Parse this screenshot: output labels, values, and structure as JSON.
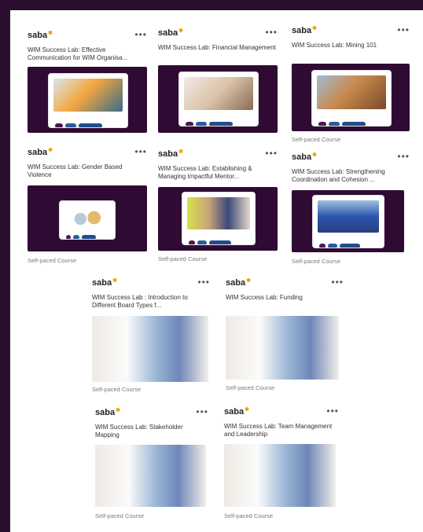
{
  "brand": "saba",
  "more_label": "•••",
  "course_type": "Self-paced Course",
  "cards": [
    {
      "title": "WIM Success Lab: Effective Communication for WIM Organisa..."
    },
    {
      "title": "WIM Success Lab: Financial Management"
    },
    {
      "title": "WIM Success Lab: Mining 101"
    },
    {
      "title": "WIM Success Lab: Gender Based Violence"
    },
    {
      "title": "WIM Success Lab: Establishing & Managing Impactful Mentor..."
    },
    {
      "title": "WIM Success Lab: Strengthening Coordination and Cohesion ..."
    },
    {
      "title": "WIM Success Lab : Introduction to Different Board Types f..."
    },
    {
      "title": "WIM Success Lab: Funding"
    },
    {
      "title": "WIM Success Lab: Stakeholder Mapping"
    },
    {
      "title": "WIM Success Lab: Team Management and Leadership"
    }
  ],
  "colors": {
    "dark_purple": "#2f0b33",
    "brand_star": "#e8a100"
  }
}
